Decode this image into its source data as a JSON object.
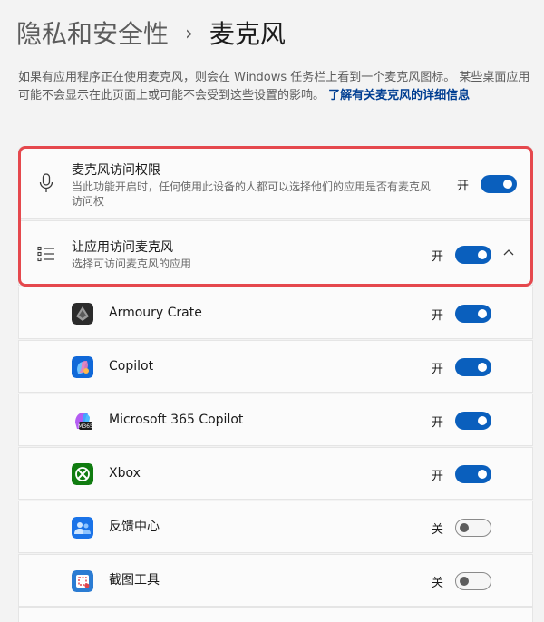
{
  "breadcrumb": {
    "parent": "隐私和安全性",
    "separator": "›",
    "current": "麦克风"
  },
  "description": {
    "line1": "如果有应用程序正在使用麦克风，则会在 Windows 任务栏上看到一个麦克风图标。 某些桌面应用可能不会显示在此页面上或可能不会受到这些设置的影响。",
    "link": "了解有关麦克风的详细信息"
  },
  "microphone_access": {
    "icon": "microphone-icon",
    "title": "麦克风访问权限",
    "subtitle": "当此功能开启时，任何使用此设备的人都可以选择他们的应用是否有麦克风访问权",
    "state": "开",
    "on": true
  },
  "app_access": {
    "icon": "list-icon",
    "title": "让应用访问麦克风",
    "subtitle": "选择可访问麦克风的应用",
    "state": "开",
    "on": true,
    "expanded": true
  },
  "apps": [
    {
      "name": "Armoury Crate",
      "state": "开",
      "on": true,
      "icon": "armoury-crate-icon"
    },
    {
      "name": "Copilot",
      "state": "开",
      "on": true,
      "icon": "copilot-icon"
    },
    {
      "name": "Microsoft 365 Copilot",
      "state": "开",
      "on": true,
      "icon": "m365-copilot-icon"
    },
    {
      "name": "Xbox",
      "state": "开",
      "on": true,
      "icon": "xbox-icon"
    },
    {
      "name": "反馈中心",
      "state": "关",
      "on": false,
      "icon": "feedback-hub-icon"
    },
    {
      "name": "截图工具",
      "state": "关",
      "on": false,
      "icon": "snipping-tool-icon"
    }
  ],
  "colors": {
    "accent": "#0a5fbd",
    "highlight": "#e5484d",
    "link": "#003e92"
  }
}
